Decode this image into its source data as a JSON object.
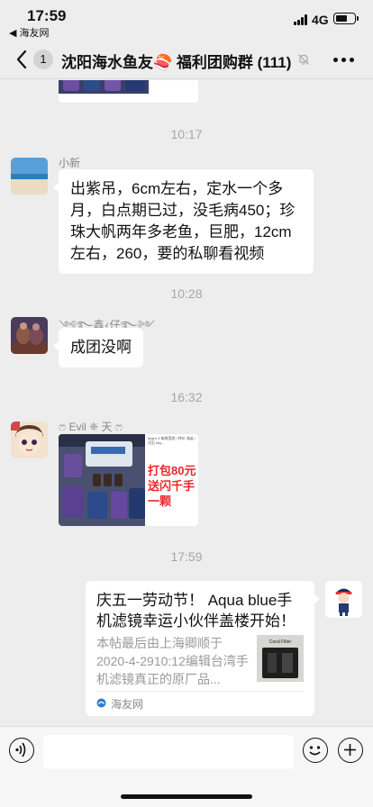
{
  "status": {
    "time": "17:59",
    "back_app": "◀ 海友网",
    "network": "4G"
  },
  "nav": {
    "unread_count": "1",
    "title": "沈阳海水鱼友🍣 福利团购群 (111)"
  },
  "messages": {
    "time1": "10:17",
    "msg1": {
      "sender": "小新",
      "text": "出紫吊，6cm左右，定水一个多月，白点期已过，没毛病450；珍珠大帆两年多老鱼，巨肥，12cm左右，260，要的私聊看视频"
    },
    "time2": "10:28",
    "msg2": {
      "sender": "༺࿐鑫ｨ仔࿐༻",
      "text": "成团没啊"
    },
    "time3": "16:32",
    "msg3": {
      "sender": "ෆ Evil ❈ 天 ෆ",
      "promo_text": "打包80元送闪千手一颗",
      "mini_text": "Mgen 3 每周宽底 / 特价 海盐 / 活石 Mg..."
    },
    "time4": "17:59",
    "link": {
      "title": "庆五一劳动节！ Aqua blue手机滤镜幸运小伙伴盖楼开始！",
      "desc": "本帖最后由上海卿顺于2020-4-2910:12编辑台湾手机滤镜真正的原厂品...",
      "thumb_label": "Coral Filter",
      "source": "海友网"
    }
  },
  "input": {
    "placeholder": ""
  },
  "colors": {
    "background": "#ededed",
    "bubble": "#ffffff",
    "promo_red": "#e8262a"
  }
}
